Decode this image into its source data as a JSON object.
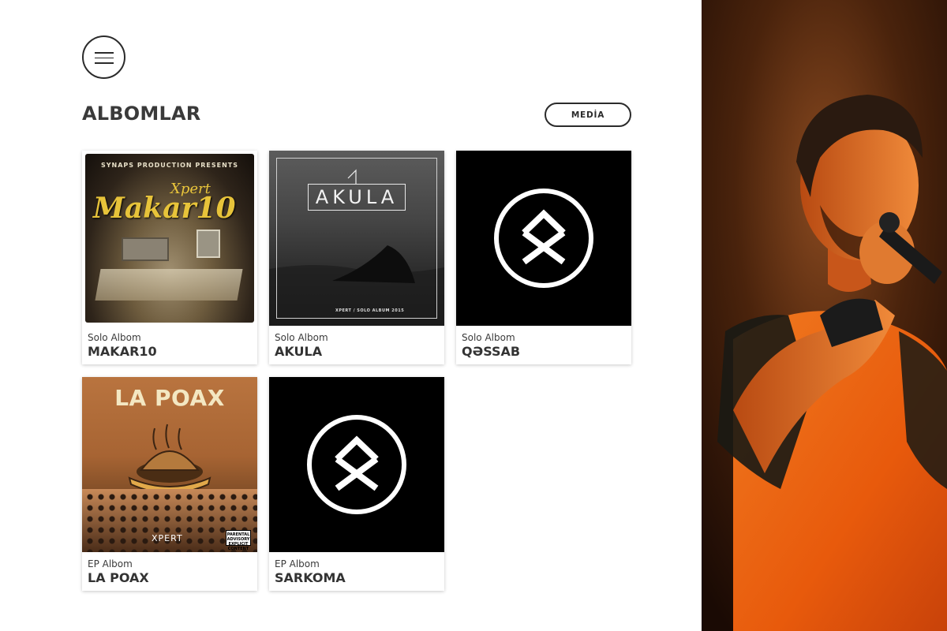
{
  "menu": {
    "icon": "hamburger-menu-icon"
  },
  "header": {
    "title": "ALBOMLAR",
    "media_label": "MEDİA"
  },
  "albums": [
    {
      "type": "Solo Albom",
      "title": "MAKAR10",
      "cover": {
        "presents": "SYNAPS PRODUCTION PRESENTS",
        "artist": "Xpert",
        "name": "Makar10"
      }
    },
    {
      "type": "Solo Albom",
      "title": "AKULA",
      "cover": {
        "name": "AKULA",
        "footer": "XPERT / SOLO ALBUM 2015"
      }
    },
    {
      "type": "Solo Albom",
      "title": "QƏSSAB",
      "cover": {
        "logo": "circle-rune-logo"
      }
    },
    {
      "type": "EP Albom",
      "title": "LA POAX",
      "cover": {
        "name": "LA POAX",
        "artist": "XPERT",
        "advisory": "PARENTAL ADVISORY EXPLICIT CONTENT"
      }
    },
    {
      "type": "EP Albom",
      "title": "SARKOMA",
      "cover": {
        "logo": "circle-rune-logo"
      }
    }
  ],
  "side_photo": {
    "subject": "performer-with-microphone"
  },
  "colors": {
    "text": "#333333",
    "accent_orange": "#e85a0c",
    "background": "#ffffff"
  }
}
